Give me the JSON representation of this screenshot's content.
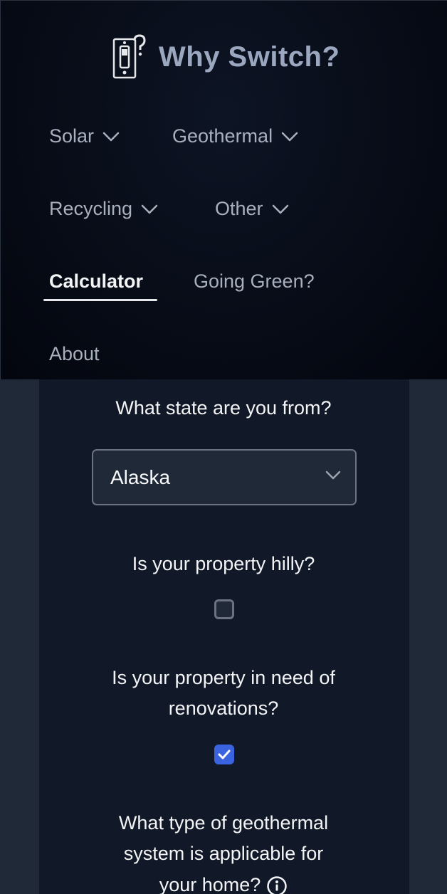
{
  "header": {
    "brand_title": "Why Switch?",
    "nav": [
      {
        "label": "Solar",
        "dropdown": true
      },
      {
        "label": "Geothermal",
        "dropdown": true
      },
      {
        "label": "Recycling",
        "dropdown": true
      },
      {
        "label": "Other",
        "dropdown": true
      },
      {
        "label": "Calculator",
        "active": true
      },
      {
        "label": "Going Green?"
      },
      {
        "label": "About"
      }
    ]
  },
  "form": {
    "state_question": "What state are you from?",
    "state_value": "Alaska",
    "hilly_question": "Is your property hilly?",
    "hilly_checked": false,
    "renovation_question_line1": "Is your property in need of",
    "renovation_question_line2": "renovations?",
    "renovation_checked": true,
    "geo_question_line1": "What type of geothermal",
    "geo_question_line2": "system is applicable for",
    "geo_question_line3": "your home?"
  },
  "colors": {
    "accent": "#3b63e0",
    "panel_bg": "#111827",
    "page_bg": "#1f2937"
  }
}
